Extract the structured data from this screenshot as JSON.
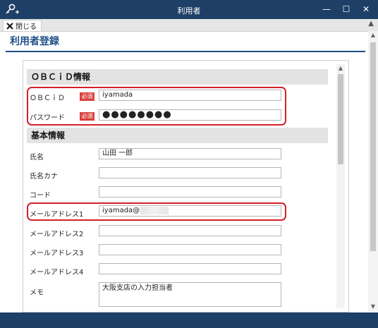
{
  "window": {
    "title": "利用者",
    "min_glyph": "—",
    "max_glyph": "☐",
    "close_glyph": "✕"
  },
  "toolbar": {
    "close_label": "閉じる",
    "collapse_glyph": "▲"
  },
  "page": {
    "title": "利用者登録"
  },
  "sections": {
    "obcid": {
      "heading": "ＯＢＣｉＤ情報"
    },
    "basic": {
      "heading": "基本情報"
    }
  },
  "fields": {
    "obcid": {
      "label": "ＯＢＣｉＤ",
      "badge": "必須",
      "value": "iyamada"
    },
    "password": {
      "label": "パスワード",
      "badge": "必須",
      "value": "●●●●●●●●"
    },
    "name": {
      "label": "氏名",
      "value": "山田 一郎"
    },
    "name_kana": {
      "label": "氏名カナ",
      "value": ""
    },
    "code": {
      "label": "コード",
      "value": ""
    },
    "email1": {
      "label": "メールアドレス1",
      "value": "iyamada@"
    },
    "email2": {
      "label": "メールアドレス2",
      "value": ""
    },
    "email3": {
      "label": "メールアドレス3",
      "value": ""
    },
    "email4": {
      "label": "メールアドレス4",
      "value": ""
    },
    "memo": {
      "label": "メモ",
      "value": "大阪支店の入力担当者"
    }
  },
  "scroll": {
    "up_glyph": "▲",
    "down_glyph": "▼"
  },
  "colors": {
    "titlebar": "#1e3f66",
    "accent": "#1e4f86",
    "required": "#d9403c",
    "highlight": "#d32028"
  },
  "icons": {
    "app": "key-add-icon",
    "close": "close-x-icon"
  }
}
